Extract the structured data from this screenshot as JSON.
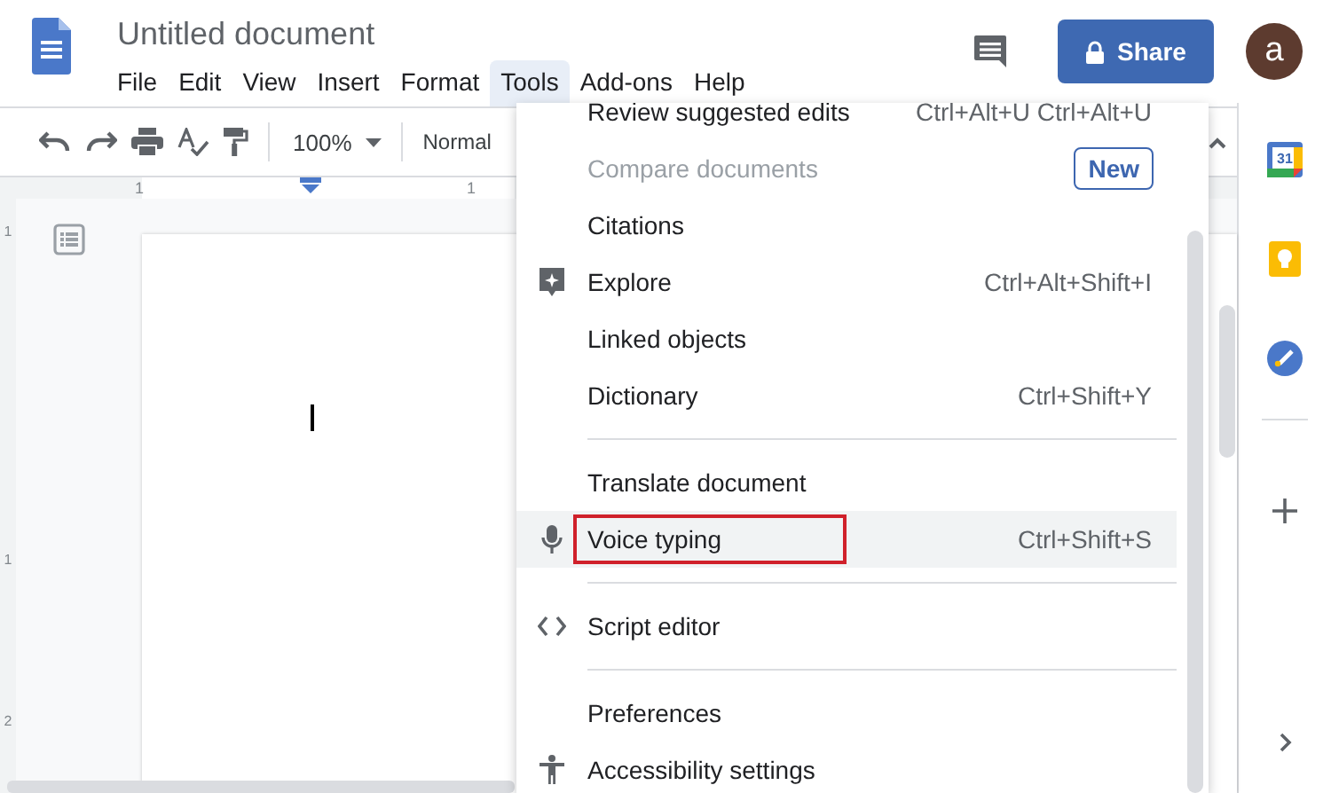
{
  "document": {
    "title": "Untitled document"
  },
  "menubar": [
    {
      "label": "File",
      "selected": false
    },
    {
      "label": "Edit",
      "selected": false
    },
    {
      "label": "View",
      "selected": false
    },
    {
      "label": "Insert",
      "selected": false
    },
    {
      "label": "Format",
      "selected": false
    },
    {
      "label": "Tools",
      "selected": true
    },
    {
      "label": "Add-ons",
      "selected": false
    },
    {
      "label": "Help",
      "selected": false
    }
  ],
  "share_button": {
    "label": "Share"
  },
  "avatar": {
    "initial": "a"
  },
  "toolbar": {
    "zoom": "100%",
    "style": "Normal"
  },
  "ruler": {
    "labels": [
      "1",
      "1"
    ],
    "vertical_labels": [
      "1",
      "1",
      "2"
    ]
  },
  "side_panel": {
    "calendar_day": "31"
  },
  "tools_menu": {
    "items": [
      {
        "kind": "item",
        "label": "Review suggested edits",
        "shortcut": "Ctrl+Alt+U Ctrl+Alt+U",
        "disabled": false,
        "highlighted": false,
        "annotated": false
      },
      {
        "kind": "item",
        "label": "Compare documents",
        "badge": "New",
        "disabled": true,
        "highlighted": false,
        "annotated": false
      },
      {
        "kind": "item",
        "label": "Citations",
        "disabled": false,
        "highlighted": false,
        "annotated": false
      },
      {
        "kind": "explore",
        "label": "Explore",
        "shortcut": "Ctrl+Alt+Shift+I",
        "disabled": false,
        "highlighted": false,
        "annotated": false
      },
      {
        "kind": "item",
        "label": "Linked objects",
        "disabled": false,
        "highlighted": false,
        "annotated": false
      },
      {
        "kind": "item",
        "label": "Dictionary",
        "shortcut": "Ctrl+Shift+Y",
        "disabled": false,
        "highlighted": false,
        "annotated": false
      },
      {
        "kind": "separator"
      },
      {
        "kind": "item",
        "label": "Translate document",
        "disabled": false,
        "highlighted": false,
        "annotated": false
      },
      {
        "kind": "voice",
        "label": "Voice typing",
        "shortcut": "Ctrl+Shift+S",
        "disabled": false,
        "highlighted": true,
        "annotated": true
      },
      {
        "kind": "separator"
      },
      {
        "kind": "script",
        "label": "Script editor",
        "disabled": false,
        "highlighted": false,
        "annotated": false
      },
      {
        "kind": "separator"
      },
      {
        "kind": "item",
        "label": "Preferences",
        "disabled": false,
        "highlighted": false,
        "annotated": false
      },
      {
        "kind": "accessibility",
        "label": "Accessibility settings",
        "disabled": false,
        "highlighted": false,
        "annotated": false
      }
    ]
  }
}
